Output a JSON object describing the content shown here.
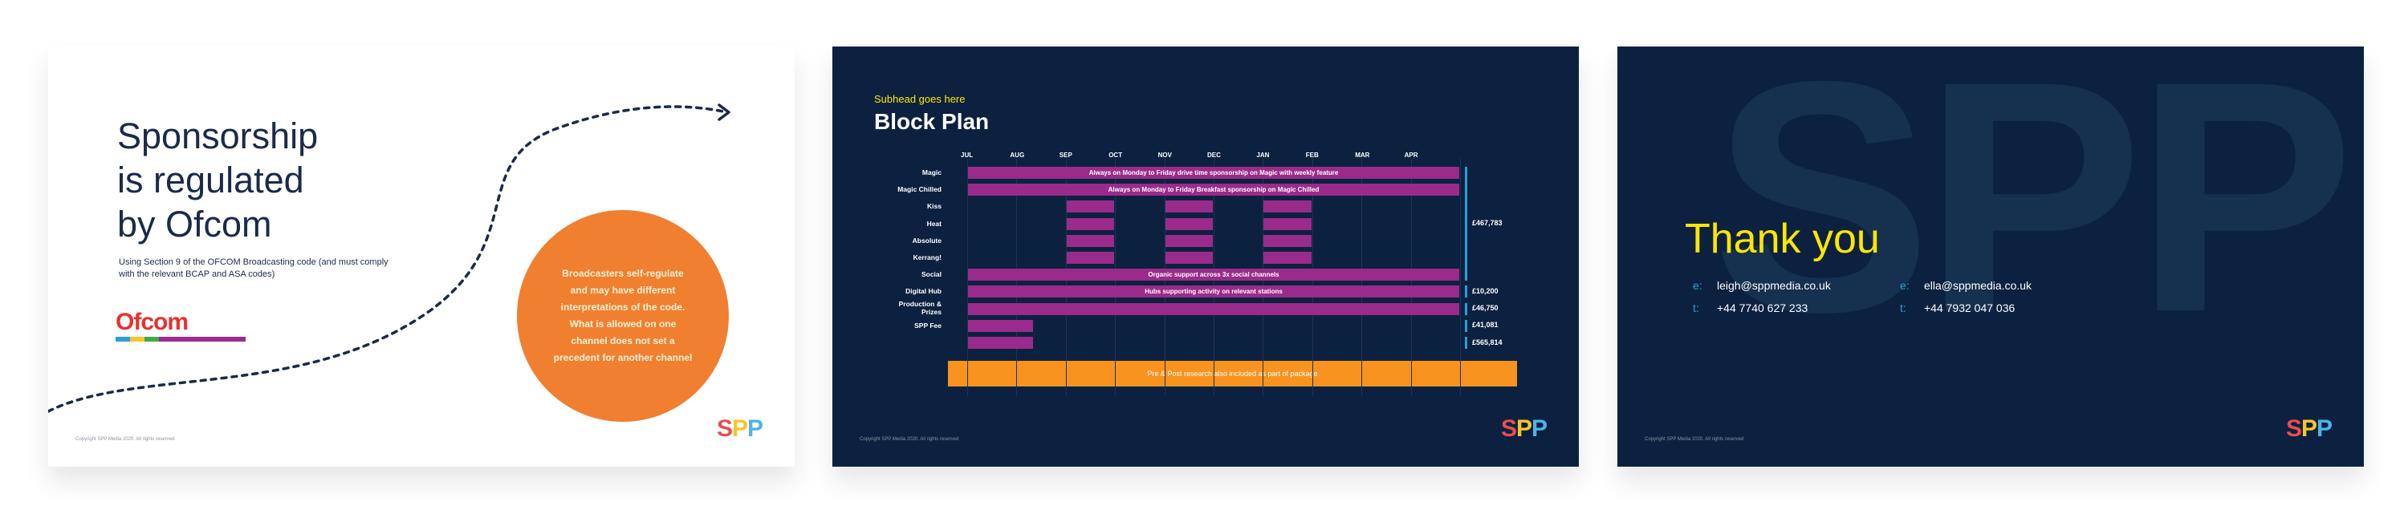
{
  "slide1": {
    "title": [
      "Sponsorship",
      "is regulated",
      "by Ofcom"
    ],
    "subtitle": "Using Section 9 of the OFCOM Broadcasting code (and must comply with the relevant BCAP and ASA codes)",
    "logo_text": "Ofcom",
    "callout": "Broadcasters self-regulate and may have different interpretations of the code. What is allowed on one channel does not set a precedent for another channel",
    "copyright": "Copyright SPP Media 2020. All rights reserved",
    "colors": {
      "accent": "#f07f30",
      "logo_bar": "#9a2b8a"
    }
  },
  "slide2": {
    "subhead": "Subhead goes here",
    "title": "Block Plan",
    "copyright": "Copyright SPP Media 2020. All rights reserved",
    "colors": {
      "background": "#0c2140",
      "bar": "#9a2b8a",
      "orange": "#f7931e",
      "bracket": "#2a9fd8"
    },
    "chart_data": {
      "type": "bar",
      "months": [
        "JUL",
        "AUG",
        "SEP",
        "OCT",
        "NOV",
        "DEC",
        "JAN",
        "FEB",
        "MAR",
        "APR"
      ],
      "rows": [
        {
          "label": "Magic",
          "bars": [
            {
              "start": 0,
              "end": 10,
              "text": "Always on Monday to Friday drive time sponsorship on Magic with weekly feature"
            }
          ]
        },
        {
          "label": "Magic Chilled",
          "bars": [
            {
              "start": 0,
              "end": 10,
              "text": "Always on Monday to Friday Breakfast sponsorship on Magic Chilled"
            }
          ]
        },
        {
          "label": "Kiss",
          "bars": [
            {
              "start": 2,
              "end": 3,
              "text": ""
            },
            {
              "start": 4,
              "end": 5,
              "text": ""
            },
            {
              "start": 6,
              "end": 7,
              "text": ""
            }
          ]
        },
        {
          "label": "Heat",
          "bars": [
            {
              "start": 2,
              "end": 3,
              "text": ""
            },
            {
              "start": 4,
              "end": 5,
              "text": ""
            },
            {
              "start": 6,
              "end": 7,
              "text": ""
            }
          ]
        },
        {
          "label": "Absolute",
          "bars": [
            {
              "start": 2,
              "end": 3,
              "text": ""
            },
            {
              "start": 4,
              "end": 5,
              "text": ""
            },
            {
              "start": 6,
              "end": 7,
              "text": ""
            }
          ]
        },
        {
          "label": "Kerrang!",
          "bars": [
            {
              "start": 2,
              "end": 3,
              "text": ""
            },
            {
              "start": 4,
              "end": 5,
              "text": ""
            },
            {
              "start": 6,
              "end": 7,
              "text": ""
            }
          ]
        },
        {
          "label": "Social",
          "bars": [
            {
              "start": 0,
              "end": 10,
              "text": "Organic support across 3x social channels"
            }
          ]
        },
        {
          "label": "Digital Hub",
          "bars": [
            {
              "start": 0,
              "end": 10,
              "text": "Hubs supporting activity on relevant stations"
            }
          ]
        },
        {
          "label": "Production & Prizes",
          "bars": [
            {
              "start": 0,
              "end": 10,
              "text": ""
            }
          ]
        },
        {
          "label": "SPP Fee",
          "bars": [
            {
              "start": 0,
              "end": 1.35,
              "text": ""
            }
          ]
        },
        {
          "label": "",
          "bars": [
            {
              "start": 0,
              "end": 1.35,
              "text": ""
            }
          ]
        }
      ],
      "totals": [
        {
          "rows": [
            0,
            6
          ],
          "value": "£467,783"
        },
        {
          "rows": [
            7,
            7
          ],
          "value": "£10,200"
        },
        {
          "rows": [
            8,
            8
          ],
          "value": "£46,750"
        },
        {
          "rows": [
            9,
            9
          ],
          "value": "£41,081"
        },
        {
          "rows": [
            10,
            10
          ],
          "value": "£565,814"
        }
      ],
      "footer_bar": "Pre & Post research also included as part of package"
    }
  },
  "slide3": {
    "watermark": "SPP",
    "title": "Thank you",
    "contacts": [
      {
        "email_label": "e:",
        "email": "leigh@sppmedia.co.uk",
        "tel_label": "t:",
        "tel": "+44 7740 627 233"
      },
      {
        "email_label": "e:",
        "email": "ella@sppmedia.co.uk",
        "tel_label": "t:",
        "tel": "+44 7932 047 036"
      }
    ],
    "copyright": "Copyright SPP Media 2020. All rights reserved"
  },
  "brand": {
    "logo": [
      "S",
      "P",
      "P"
    ]
  }
}
